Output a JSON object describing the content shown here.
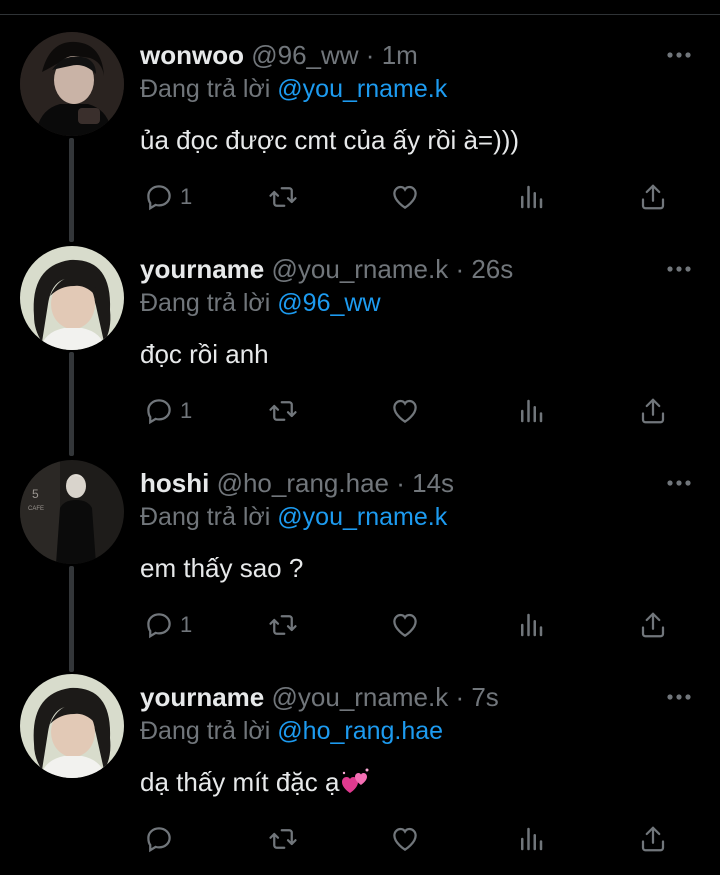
{
  "colors": {
    "background": "#000000",
    "text": "#e7e9ea",
    "muted": "#71767b",
    "link": "#1d9bf0",
    "thread": "#333639"
  },
  "reply_prefix": "Đang trả lời",
  "tweets": [
    {
      "name": "wonwoo",
      "handle": "@96_ww",
      "dot": "·",
      "time": "1m",
      "mention": "@you_rname.k",
      "text": "ủa đọc được cmt của ấy rồi à=)))",
      "reply_count": "1",
      "icons": [
        "reply-icon",
        "retweet-icon",
        "like-icon",
        "analytics-icon",
        "share-icon",
        "more-icon"
      ]
    },
    {
      "name": "yourname",
      "handle": "@you_rname.k",
      "dot": "·",
      "time": "26s",
      "mention": "@96_ww",
      "text": "đọc rồi anh",
      "reply_count": "1"
    },
    {
      "name": "hoshi",
      "handle": "@ho_rang.hae",
      "dot": "·",
      "time": "14s",
      "mention": "@you_rname.k",
      "text": "em thấy sao ?",
      "reply_count": "1"
    },
    {
      "name": "yourname",
      "handle": "@you_rname.k",
      "dot": "·",
      "time": "7s",
      "mention": "@ho_rang.hae",
      "text": "dạ thấy mít đặc ạ",
      "emoji": "two-hearts-emoji",
      "reply_count": ""
    }
  ]
}
